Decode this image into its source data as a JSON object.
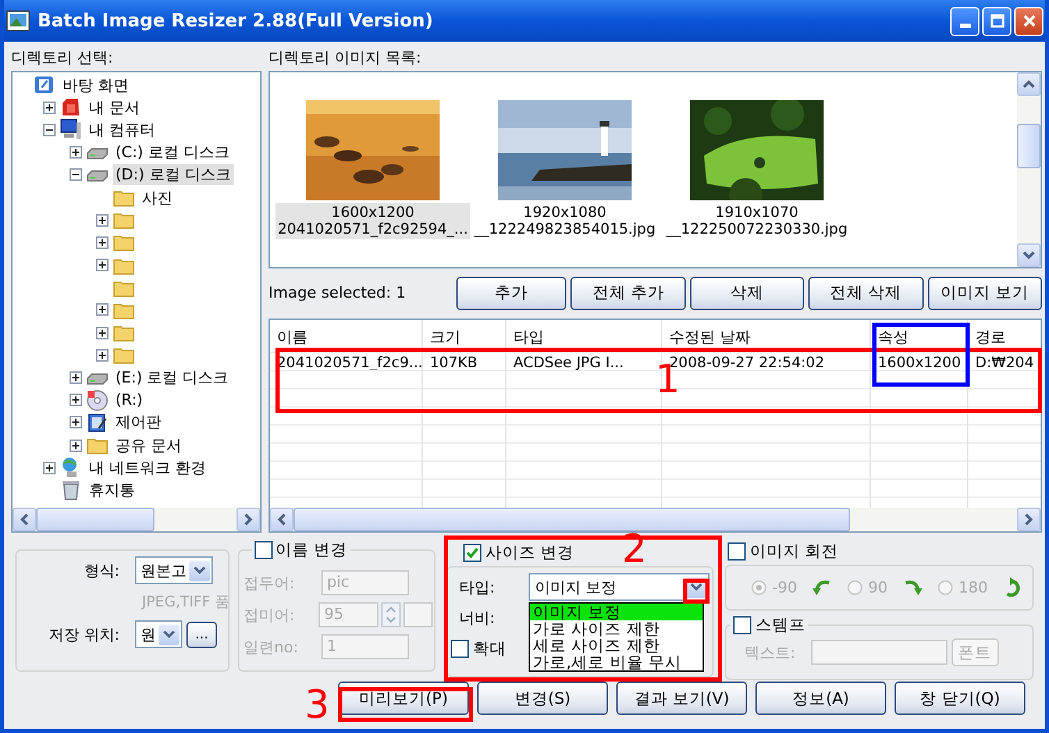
{
  "window": {
    "title": "Batch Image Resizer 2.88(Full Version)"
  },
  "directory_panel": {
    "label": "디렉토리 선택:"
  },
  "tree": [
    {
      "label": "바탕 화면",
      "kind": "desktop",
      "selected": false,
      "children": [
        {
          "label": "내 문서",
          "kind": "documents",
          "expanded": false,
          "selected": false
        },
        {
          "label": "내 컴퓨터",
          "kind": "computer",
          "expanded": true,
          "selected": false,
          "children": [
            {
              "label": "(C:) 로컬 디스크",
              "kind": "drive",
              "expanded": false,
              "selected": false
            },
            {
              "label": "(D:) 로컬 디스크",
              "kind": "drive",
              "expanded": true,
              "selected": true,
              "children": [
                {
                  "label": "사진",
                  "kind": "folder",
                  "selected": false
                },
                {
                  "kind": "folder",
                  "expanded": false,
                  "selected": false
                },
                {
                  "kind": "folder",
                  "expanded": false,
                  "selected": false
                },
                {
                  "kind": "folder",
                  "expanded": false,
                  "selected": false
                },
                {
                  "kind": "folder",
                  "selected": false
                },
                {
                  "kind": "folder",
                  "expanded": false,
                  "selected": false
                },
                {
                  "kind": "folder",
                  "expanded": false,
                  "selected": false
                },
                {
                  "kind": "folder",
                  "expanded": false,
                  "selected": false
                }
              ]
            },
            {
              "label": "(E:) 로컬 디스크",
              "kind": "drive",
              "expanded": false,
              "selected": false
            },
            {
              "label": "(R:)",
              "kind": "cd",
              "expanded": false,
              "selected": false
            },
            {
              "label": "제어판",
              "kind": "control-panel",
              "expanded": false,
              "selected": false
            },
            {
              "label": "공유 문서",
              "kind": "folder",
              "expanded": false,
              "selected": false
            }
          ]
        },
        {
          "label": "내 네트워크 환경",
          "kind": "network",
          "expanded": false,
          "selected": false
        },
        {
          "label": "휴지통",
          "kind": "trash",
          "selected": false
        }
      ]
    }
  ],
  "image_panel": {
    "label": "디렉토리 이미지 목록:"
  },
  "thumbnails": [
    {
      "kind": "picture",
      "size": "1600x1200",
      "name": "2041020571_f2c92594_...",
      "selected": true
    },
    {
      "kind": "picture",
      "size": "1920x1080",
      "name": "__122249823854015.jpg",
      "selected": false
    },
    {
      "kind": "picture",
      "size": "1910x1070",
      "name": "__122250072230330.jpg",
      "selected": false
    }
  ],
  "status": "Image selected: 1",
  "image_buttons": [
    "추가",
    "전체 추가",
    "삭제",
    "전체 삭제",
    "이미지 보기"
  ],
  "table": {
    "columns": [
      "이름",
      "크기",
      "타입",
      "수정된 날짜",
      "속성",
      "경로"
    ],
    "rows": [
      [
        "2041020571_f2c9...",
        "107KB",
        "ACDSee JPG I...",
        "2008-09-27 22:54:02",
        "1600x1200",
        "D:₩204"
      ]
    ]
  },
  "format_group": {
    "format_label": "형식:",
    "format_value": "원본고",
    "quality_label": "JPEG,TIFF 품",
    "save_label": "저장 위치:",
    "save_value": "원",
    "browse": "..."
  },
  "rename_group": {
    "label": "이름 변경",
    "checked": false,
    "fields": [
      {
        "label": "접두어:",
        "value": "pic"
      },
      {
        "label": "접미어:",
        "value": "95"
      },
      {
        "label": "일련no:",
        "value": "1"
      }
    ]
  },
  "resize_group": {
    "label": "사이즈 변경",
    "checked": true,
    "type_label": "타입:",
    "type_value": "이미지 보정",
    "open": true,
    "options": [
      {
        "label": "이미지 보정",
        "selected": true
      },
      {
        "label": "가로 사이즈 제한",
        "selected": false
      },
      {
        "label": "세로 사이즈 제한",
        "selected": false
      },
      {
        "label": "가로,세로 비율 무시",
        "selected": false
      }
    ],
    "width_label": "너비:",
    "enlarge": {
      "label": "확대",
      "checked": false
    }
  },
  "rotate_group": {
    "label": "이미지 회전",
    "checked": false,
    "options": [
      {
        "label": "-90",
        "selected": true
      },
      {
        "label": "90",
        "selected": false
      },
      {
        "label": "180",
        "selected": false
      }
    ]
  },
  "stamp_group": {
    "label": "스템프",
    "checked": false,
    "text_label": "텍스트:",
    "font_button": "폰트"
  },
  "buttons": [
    "미리보기(P)",
    "변경(S)",
    "결과 보기(V)",
    "정보(A)",
    "창 닫기(Q)"
  ],
  "annotations": [
    {
      "color": "#ff0000",
      "number": "1"
    },
    {
      "color": "#0000ff"
    },
    {
      "color": "#ff0000",
      "number": "2"
    },
    {
      "color": "#ff0000"
    },
    {
      "color": "#ff0000",
      "number": "3"
    }
  ]
}
